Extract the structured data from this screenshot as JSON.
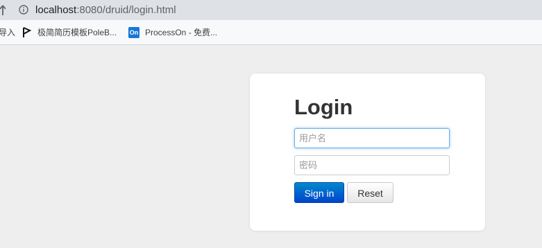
{
  "browser": {
    "url_host": "localhost",
    "url_path": ":8080/druid/login.html",
    "bookmarks": [
      {
        "label": "导入",
        "icon": "import-icon"
      },
      {
        "label": "极简简历模板PoleB...",
        "icon": "pole-icon"
      },
      {
        "label": "ProcessOn - 免费...",
        "icon": "processon-icon",
        "badge": "On"
      }
    ]
  },
  "login": {
    "title": "Login",
    "username_placeholder": "用户名",
    "password_placeholder": "密码",
    "signin_label": "Sign in",
    "reset_label": "Reset"
  },
  "colors": {
    "page_background": "#eeeeee",
    "signin_button": "#0066cc",
    "focus_ring": "#66afe9",
    "processon_badge": "#1677d8"
  }
}
